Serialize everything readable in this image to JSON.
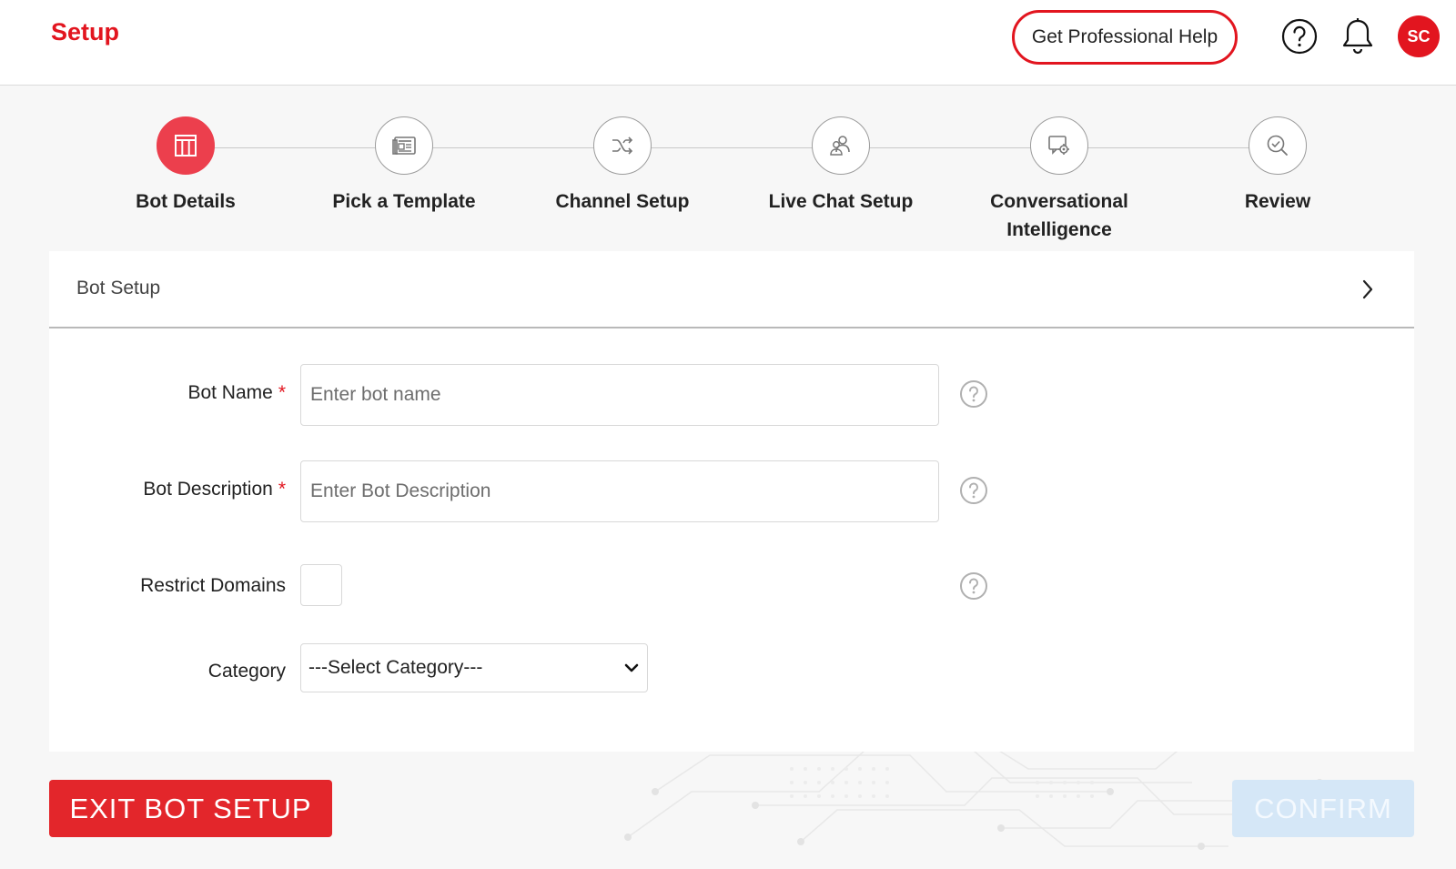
{
  "header": {
    "title": "Setup",
    "help_button_label": "Get Professional Help",
    "avatar_initials": "SC"
  },
  "steps": [
    {
      "label": "Bot Details",
      "icon": "columns-icon",
      "active": true
    },
    {
      "label": "Pick a Template",
      "icon": "template-icon",
      "active": false
    },
    {
      "label": "Channel Setup",
      "icon": "shuffle-icon",
      "active": false
    },
    {
      "label": "Live Chat Setup",
      "icon": "agents-icon",
      "active": false
    },
    {
      "label": "Conversational Intelligence",
      "icon": "chat-gear-icon",
      "active": false
    },
    {
      "label": "Review",
      "icon": "search-check-icon",
      "active": false
    }
  ],
  "card": {
    "title": "Bot Setup"
  },
  "form": {
    "bot_name": {
      "label": "Bot Name",
      "required_mark": "*",
      "placeholder": "Enter bot name",
      "value": ""
    },
    "bot_description": {
      "label": "Bot Description",
      "required_mark": "*",
      "placeholder": "Enter Bot Description",
      "value": ""
    },
    "restrict_domains": {
      "label": "Restrict Domains",
      "checked": false
    },
    "category": {
      "label": "Category",
      "selected": "---Select Category---"
    }
  },
  "footer": {
    "exit_label": "EXIT BOT SETUP",
    "confirm_label": "CONFIRM"
  },
  "colors": {
    "brand_red": "#e2151f",
    "active_step": "#ec3f4d",
    "confirm_disabled": "#d5e7f7"
  }
}
